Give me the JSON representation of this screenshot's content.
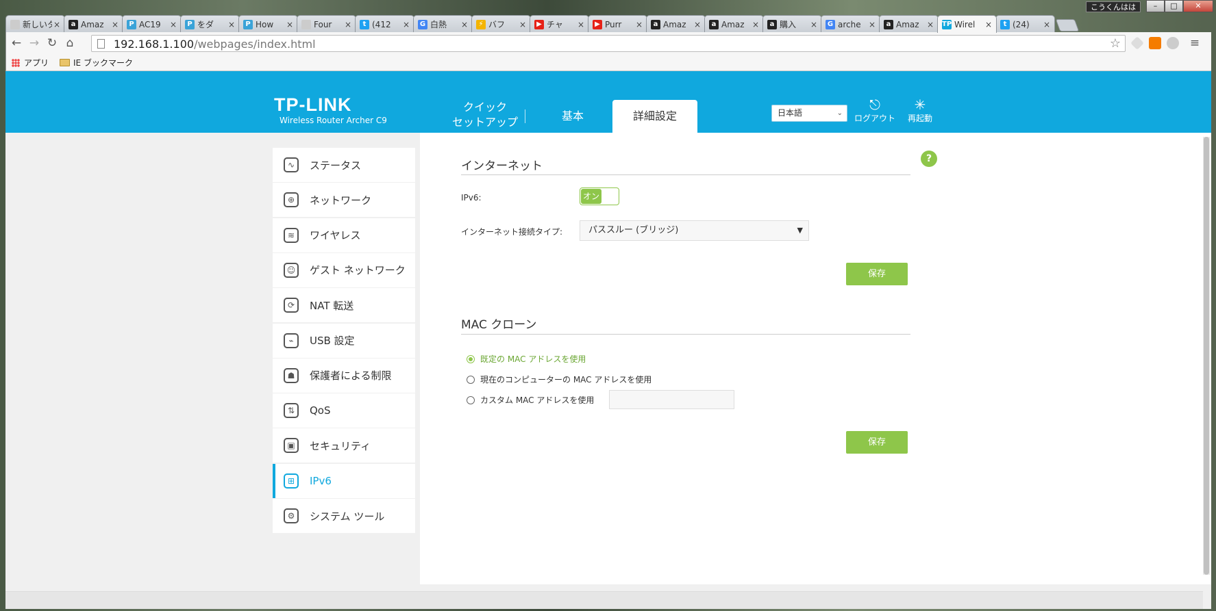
{
  "window": {
    "user_badge": "こうくんはは"
  },
  "tabs": [
    {
      "title": "新しいタ",
      "color": "#cccccc",
      "icon": "blank-page-icon"
    },
    {
      "title": "Amaz",
      "color": "#222222",
      "icon": "amazon-icon",
      "glyph": "a"
    },
    {
      "title": "AC19",
      "color": "#3aa3d8",
      "icon": "tplink-icon",
      "glyph": "P"
    },
    {
      "title": "をダ",
      "color": "#3aa3d8",
      "icon": "tplink-icon",
      "glyph": "P"
    },
    {
      "title": "How",
      "color": "#3aa3d8",
      "icon": "tplink-icon",
      "glyph": "P"
    },
    {
      "title": "Four",
      "color": "#cccccc",
      "icon": "document-icon",
      "glyph": ""
    },
    {
      "title": "(412",
      "color": "#1da1f2",
      "icon": "twitter-icon",
      "glyph": "t"
    },
    {
      "title": "白熱",
      "color": "#4285f4",
      "icon": "google-icon",
      "glyph": "G"
    },
    {
      "title": "バフ",
      "color": "#f4b400",
      "icon": "bolt-icon",
      "glyph": "⚡"
    },
    {
      "title": "チャ",
      "color": "#e62117",
      "icon": "youtube-icon",
      "glyph": "▶"
    },
    {
      "title": "Purr",
      "color": "#e62117",
      "icon": "youtube-icon",
      "glyph": "▶"
    },
    {
      "title": "Amaz",
      "color": "#222222",
      "icon": "amazon-icon",
      "glyph": "a"
    },
    {
      "title": "Amaz",
      "color": "#222222",
      "icon": "amazon-icon",
      "glyph": "a"
    },
    {
      "title": "購入",
      "color": "#222222",
      "icon": "amazon-icon",
      "glyph": "a"
    },
    {
      "title": "arche",
      "color": "#4285f4",
      "icon": "google-icon",
      "glyph": "G"
    },
    {
      "title": "Amaz",
      "color": "#222222",
      "icon": "amazon-icon",
      "glyph": "a"
    },
    {
      "title": "Wirel",
      "color": "#10a8de",
      "icon": "tplink-icon",
      "glyph": "TP",
      "active": true
    },
    {
      "title": "(24)",
      "color": "#1da1f2",
      "icon": "twitter-icon",
      "glyph": "t"
    }
  ],
  "toolbar": {
    "url_host": "192.168.1.100",
    "url_path": "/webpages/index.html"
  },
  "bookmarks": {
    "apps": "アプリ",
    "ie_bookmarks": "IE ブックマーク"
  },
  "header": {
    "logo": "TP-LINK",
    "subtitle": "Wireless Router Archer C9",
    "tab_quick_1": "クイック",
    "tab_quick_2": "セットアップ",
    "tab_basic": "基本",
    "tab_advanced": "詳細設定",
    "language": "日本語",
    "logout": "ログアウト",
    "reboot": "再起動"
  },
  "sidebar": {
    "items": [
      {
        "label": "ステータス",
        "icon": "status-icon",
        "glyph": "∿"
      },
      {
        "label": "ネットワーク",
        "icon": "globe-icon",
        "glyph": "⊕"
      },
      {
        "label": "ワイヤレス",
        "icon": "wireless-icon",
        "glyph": "≋"
      },
      {
        "label": "ゲスト ネットワーク",
        "icon": "guest-icon",
        "glyph": "☺"
      },
      {
        "label": "NAT 転送",
        "icon": "nat-icon",
        "glyph": "⟳"
      },
      {
        "label": "USB 設定",
        "icon": "usb-icon",
        "glyph": "⌁"
      },
      {
        "label": "保護者による制限",
        "icon": "parental-icon",
        "glyph": "☗"
      },
      {
        "label": "QoS",
        "icon": "qos-icon",
        "glyph": "⇅"
      },
      {
        "label": "セキュリティ",
        "icon": "lock-icon",
        "glyph": "▣"
      },
      {
        "label": "IPv6",
        "icon": "ipv6-icon",
        "glyph": "⊞",
        "active": true
      },
      {
        "label": "システム ツール",
        "icon": "gear-icon",
        "glyph": "⚙"
      }
    ]
  },
  "internet": {
    "title": "インターネット",
    "ipv6_label": "IPv6:",
    "toggle_on": "オン",
    "conn_type_label": "インターネット接続タイプ:",
    "conn_type_value": "パススルー (ブリッジ)",
    "save": "保存"
  },
  "mac": {
    "title": "MAC クローン",
    "opt_default": "既定の MAC アドレスを使用",
    "opt_computer": "現在のコンピューターの MAC アドレスを使用",
    "opt_custom": "カスタム MAC アドレスを使用",
    "save": "保存"
  },
  "help": "?",
  "colors": {
    "brand": "#10a8de",
    "accent": "#8ec64a"
  }
}
